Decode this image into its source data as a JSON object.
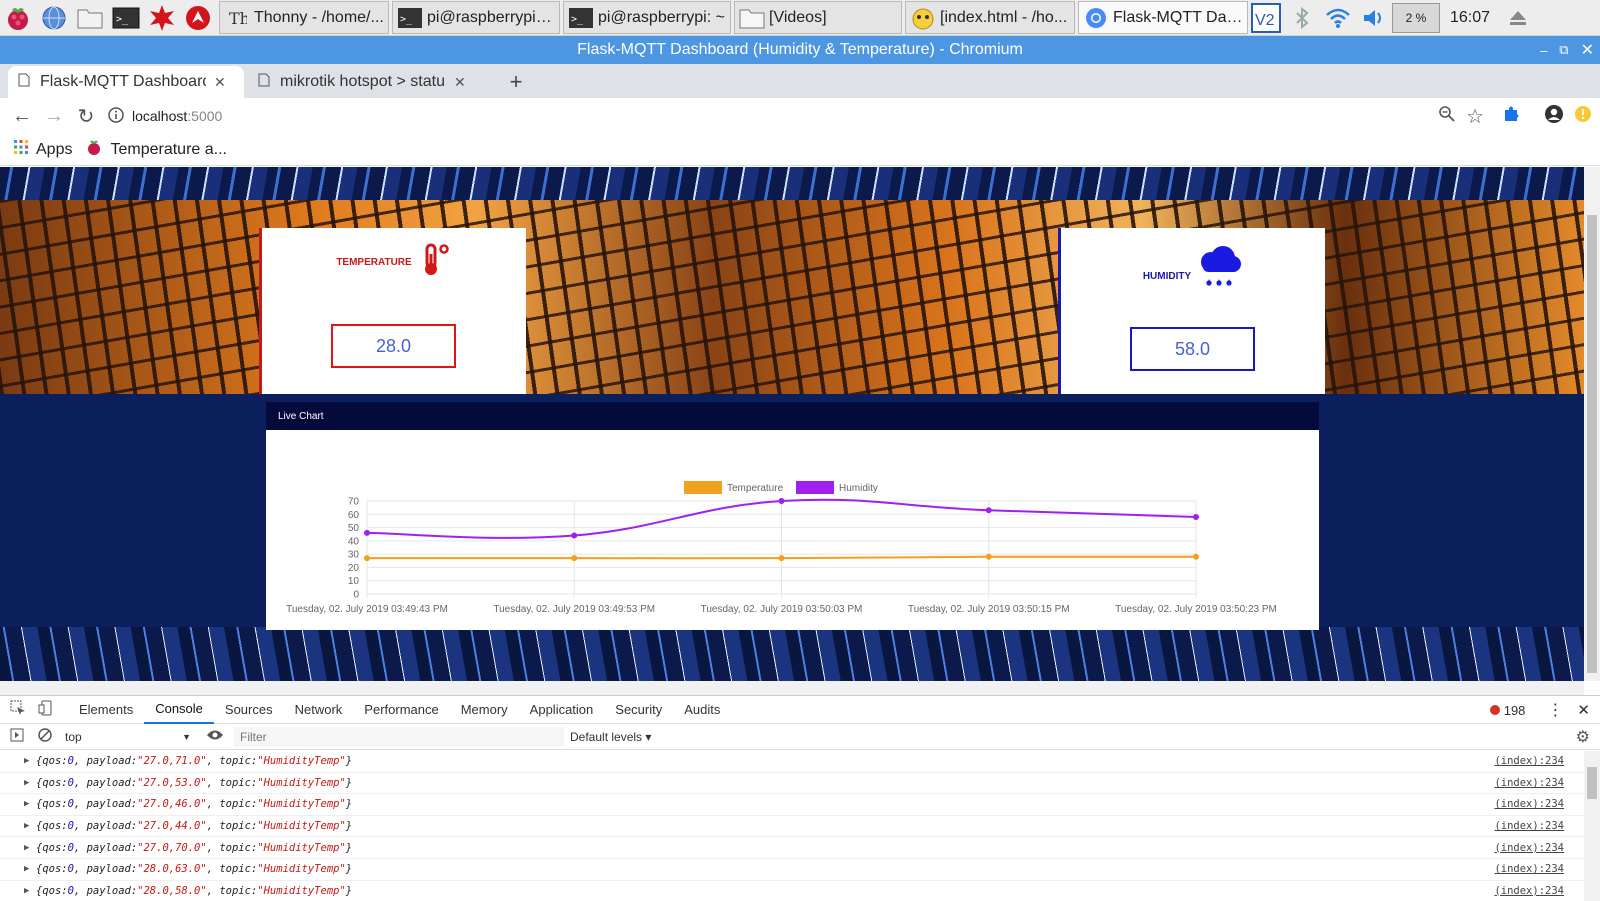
{
  "taskbar": {
    "tasks": [
      {
        "label": "Thonny  -  /home/...",
        "icon": "thonny-icon"
      },
      {
        "label": "pi@raspberrypi: ~...",
        "icon": "terminal-icon"
      },
      {
        "label": "pi@raspberrypi: ~",
        "icon": "terminal-icon"
      },
      {
        "label": "[Videos]",
        "icon": "folder-icon"
      },
      {
        "label": "[index.html - /ho...",
        "icon": "geany-icon"
      },
      {
        "label": "Flask-MQTT Dash...",
        "icon": "chromium-icon"
      }
    ],
    "cpu": "2 %",
    "clock": "16:07"
  },
  "window": {
    "title": "Flask-MQTT Dashboard (Humidity & Temperature) - Chromium"
  },
  "tabs": [
    {
      "title": "Flask-MQTT Dashboard (",
      "active": true
    },
    {
      "title": "mikrotik hotspot > statu",
      "active": false
    }
  ],
  "omnibox": {
    "host": "localhost",
    "port": ":5000"
  },
  "bookmarks": {
    "apps": "Apps",
    "item": "Temperature a..."
  },
  "dashboard": {
    "temperature": {
      "label": "TEMPERATURE",
      "value": "28.0",
      "color": "#c21b1b"
    },
    "humidity": {
      "label": "HUMIDITY",
      "value": "58.0",
      "color": "#1a1aa8"
    },
    "chart_title": "Live Chart"
  },
  "chart_data": {
    "type": "line",
    "x": [
      "Tuesday, 02. July 2019 03:49:43 PM",
      "Tuesday, 02. July 2019 03:49:53 PM",
      "Tuesday, 02. July 2019 03:50:03 PM",
      "Tuesday, 02. July 2019 03:50:15 PM",
      "Tuesday, 02. July 2019 03:50:23 PM"
    ],
    "series": [
      {
        "name": "Temperature",
        "color": "#f0a11f",
        "values": [
          27,
          27,
          27,
          28,
          28
        ]
      },
      {
        "name": "Humidity",
        "color": "#a020f0",
        "values": [
          46,
          44,
          70,
          63,
          58
        ]
      }
    ],
    "ylim": [
      0,
      70
    ],
    "yticks": [
      0,
      10,
      20,
      30,
      40,
      50,
      60,
      70
    ],
    "legend": "top",
    "grid": true
  },
  "devtools": {
    "tabs": [
      "Elements",
      "Console",
      "Sources",
      "Network",
      "Performance",
      "Memory",
      "Application",
      "Security",
      "Audits"
    ],
    "active_tab": "Console",
    "error_count": "198",
    "context": "top",
    "filter_placeholder": "Filter",
    "levels": "Default levels ▾",
    "console_rows": [
      {
        "qos": "0",
        "payload": "\"27.0,71.0\"",
        "topic": "\"HumidityTemp\"",
        "src": "(index):234"
      },
      {
        "qos": "0",
        "payload": "\"27.0,53.0\"",
        "topic": "\"HumidityTemp\"",
        "src": "(index):234"
      },
      {
        "qos": "0",
        "payload": "\"27.0,46.0\"",
        "topic": "\"HumidityTemp\"",
        "src": "(index):234"
      },
      {
        "qos": "0",
        "payload": "\"27.0,44.0\"",
        "topic": "\"HumidityTemp\"",
        "src": "(index):234"
      },
      {
        "qos": "0",
        "payload": "\"27.0,70.0\"",
        "topic": "\"HumidityTemp\"",
        "src": "(index):234"
      },
      {
        "qos": "0",
        "payload": "\"28.0,63.0\"",
        "topic": "\"HumidityTemp\"",
        "src": "(index):234"
      },
      {
        "qos": "0",
        "payload": "\"28.0,58.0\"",
        "topic": "\"HumidityTemp\"",
        "src": "(index):234"
      }
    ]
  }
}
